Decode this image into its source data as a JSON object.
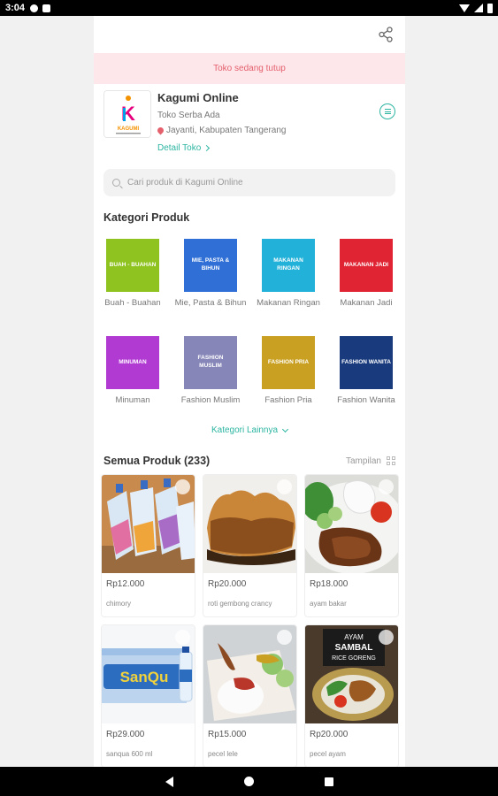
{
  "status_bar": {
    "time": "3:04"
  },
  "banner": {
    "text": "Toko sedang tutup"
  },
  "store": {
    "name": "Kagumi Online",
    "tagline": "Toko Serba Ada",
    "location": "Jayanti, Kabupaten Tangerang",
    "detail_link": "Detail Toko",
    "logo_letter": "K",
    "logo_text": "KAGUMI"
  },
  "search": {
    "placeholder": "Cari produk di Kagumi Online"
  },
  "categories": {
    "title": "Kategori Produk",
    "more_label": "Kategori Lainnya",
    "items": [
      {
        "label": "Buah - Buahan",
        "tile_text": "Buah - Buahan",
        "color": "#8fc31f"
      },
      {
        "label": "Mie, Pasta & Bihun",
        "tile_text": "Mie, Pasta & Bihun",
        "color": "#2f6fd6"
      },
      {
        "label": "Makanan Ringan",
        "tile_text": "Makanan Ringan",
        "color": "#22b1d9"
      },
      {
        "label": "Makanan Jadi",
        "tile_text": "Makanan Jadi",
        "color": "#e02434"
      },
      {
        "label": "Minuman",
        "tile_text": "Minuman",
        "color": "#b13ad3"
      },
      {
        "label": "Fashion Muslim",
        "tile_text": "Fashion Muslim",
        "color": "#8686b8"
      },
      {
        "label": "Fashion Pria",
        "tile_text": "Fashion Pria",
        "color": "#c9a021"
      },
      {
        "label": "Fashion Wanita",
        "tile_text": "Fashion Wanita",
        "color": "#193b7e"
      }
    ]
  },
  "products": {
    "title": "Semua Produk (233)",
    "view_label": "Tampilan",
    "items": [
      {
        "price": "Rp12.000",
        "name": "chimory",
        "image": "drink-pouches"
      },
      {
        "price": "Rp20.000",
        "name": "roti gembong crancy",
        "image": "bread-loaf"
      },
      {
        "price": "Rp18.000",
        "name": "ayam bakar",
        "image": "grilled-chicken-plate"
      },
      {
        "price": "Rp29.000",
        "name": "sanqua 600 ml",
        "image": "water-bottles-case"
      },
      {
        "price": "Rp15.000",
        "name": "pecel lele",
        "image": "fried-catfish-rice-box"
      },
      {
        "price": "Rp20.000",
        "name": "pecel ayam",
        "image": "sambal-chicken-plate"
      }
    ]
  }
}
